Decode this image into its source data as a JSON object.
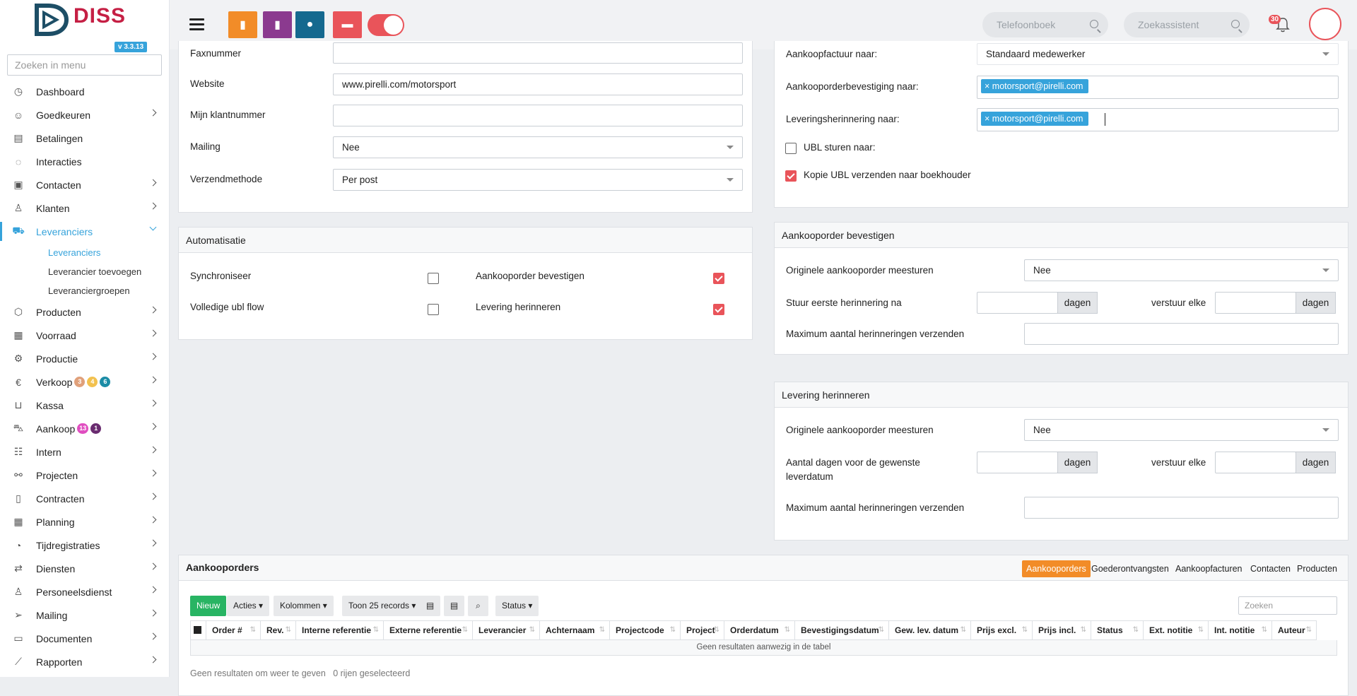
{
  "app": {
    "logo_text": "DISS",
    "version": "v 3.3.13",
    "menu_search_placeholder": "Zoeken in menu"
  },
  "sidebar": {
    "items": [
      {
        "label": "Dashboard",
        "icon": "dashboard-icon"
      },
      {
        "label": "Goedkeuren",
        "icon": "user-check-icon"
      },
      {
        "label": "Betalingen",
        "icon": "payment-icon"
      },
      {
        "label": "Interacties",
        "icon": "chat-icon"
      },
      {
        "label": "Contacten",
        "icon": "contact-card-icon"
      },
      {
        "label": "Klanten",
        "icon": "customer-icon"
      },
      {
        "label": "Leveranciers",
        "icon": "truck-icon"
      },
      {
        "label": "Producten",
        "icon": "box-icon"
      },
      {
        "label": "Voorraad",
        "icon": "boxes-icon"
      },
      {
        "label": "Productie",
        "icon": "gears-icon"
      },
      {
        "label": "Verkoop",
        "icon": "euro-icon",
        "badges": [
          "3",
          "4",
          "6"
        ]
      },
      {
        "label": "Kassa",
        "icon": "basket-icon"
      },
      {
        "label": "Aankoop",
        "icon": "cart-icon",
        "badges": [
          "13",
          "1"
        ]
      },
      {
        "label": "Intern",
        "icon": "team-icon"
      },
      {
        "label": "Projecten",
        "icon": "project-icon"
      },
      {
        "label": "Contracten",
        "icon": "contract-icon"
      },
      {
        "label": "Planning",
        "icon": "calendar-icon"
      },
      {
        "label": "Tijdregistraties",
        "icon": "timer-icon"
      },
      {
        "label": "Diensten",
        "icon": "sync-icon"
      },
      {
        "label": "Personeelsdienst",
        "icon": "staff-icon"
      },
      {
        "label": "Mailing",
        "icon": "send-icon"
      },
      {
        "label": "Documenten",
        "icon": "folder-icon"
      },
      {
        "label": "Rapporten",
        "icon": "chart-line-icon"
      }
    ],
    "sub_items": [
      "Leveranciers",
      "Leverancier toevoegen",
      "Leveranciergroepen"
    ]
  },
  "topbar": {
    "phonebook_placeholder": "Telefoonboek",
    "search_assistant_placeholder": "Zoekassistent",
    "notification_count": "30"
  },
  "left_form": {
    "rows": [
      {
        "label": "Faxnummer",
        "value": ""
      },
      {
        "label": "Website",
        "value": "www.pirelli.com/motorsport"
      },
      {
        "label": "Mijn klantnummer",
        "value": ""
      },
      {
        "label": "Mailing",
        "value": "Nee"
      },
      {
        "label": "Verzendmethode",
        "value": "Per post"
      }
    ]
  },
  "automatisatie": {
    "title": "Automatisatie",
    "synchroniseer": "Synchroniseer",
    "volledige_ubl_flow": "Volledige ubl flow",
    "aankooporder_bevestigen": "Aankooporder bevestigen",
    "levering_herinneren": "Levering herinneren"
  },
  "right_form": {
    "aankoopfactuur_label": "Aankoopfactuur naar:",
    "aankoopfactuur_value": "Standaard medewerker",
    "bevestiging_label": "Aankooporderbevestiging naar:",
    "bevestiging_tag": "motorsport@pirelli.com",
    "herinnering_label": "Leveringsherinnering naar:",
    "herinnering_tag": "motorsport@pirelli.com",
    "ubl_label": "UBL sturen naar:",
    "kopie_ubl_label": "Kopie UBL verzenden naar boekhouder"
  },
  "bevestigen": {
    "title": "Aankooporder bevestigen",
    "originele_label": "Originele aankooporder meesturen",
    "originele_value": "Nee",
    "eerste_label": "Stuur eerste herinnering na",
    "dagen": "dagen",
    "verstuur_elke": "verstuur elke",
    "max_label": "Maximum aantal herinneringen verzenden"
  },
  "herinneren": {
    "title": "Levering herinneren",
    "originele_label": "Originele aankooporder meesturen",
    "originele_value": "Nee",
    "aantal_label_1": "Aantal dagen voor de gewenste",
    "aantal_label_2": "leverdatum",
    "dagen": "dagen",
    "verstuur_elke": "verstuur elke",
    "max_label": "Maximum aantal herinneringen verzenden"
  },
  "orders": {
    "title": "Aankooporders",
    "tabs": [
      "Aankooporders",
      "Goederontvangsten",
      "Aankoopfacturen",
      "Contacten",
      "Producten"
    ],
    "buttons": {
      "new": "Nieuw",
      "actions": "Acties",
      "columns": "Kolommen",
      "show": "Toon 25 records",
      "status": "Status"
    },
    "search_placeholder": "Zoeken",
    "columns": [
      "Order #",
      "Rev.",
      "Interne referentie",
      "Externe referentie",
      "Leverancier",
      "Achternaam",
      "Projectcode",
      "Project",
      "Orderdatum",
      "Bevestigingsdatum",
      "Gew. lev. datum",
      "Prijs excl.",
      "Prijs incl.",
      "Status",
      "Ext. notitie",
      "Int. notitie",
      "Auteur"
    ],
    "empty": "Geen resultaten aanwezig in de tabel",
    "footer": "Geen resultaten om weer te geven   0 rijen geselecteerd"
  },
  "colors": {
    "accent_blue": "#36a3db",
    "orange": "#f28c28",
    "purple": "#8b3a8f",
    "teal": "#15698f",
    "red": "#e9545a",
    "green": "#28b463"
  }
}
